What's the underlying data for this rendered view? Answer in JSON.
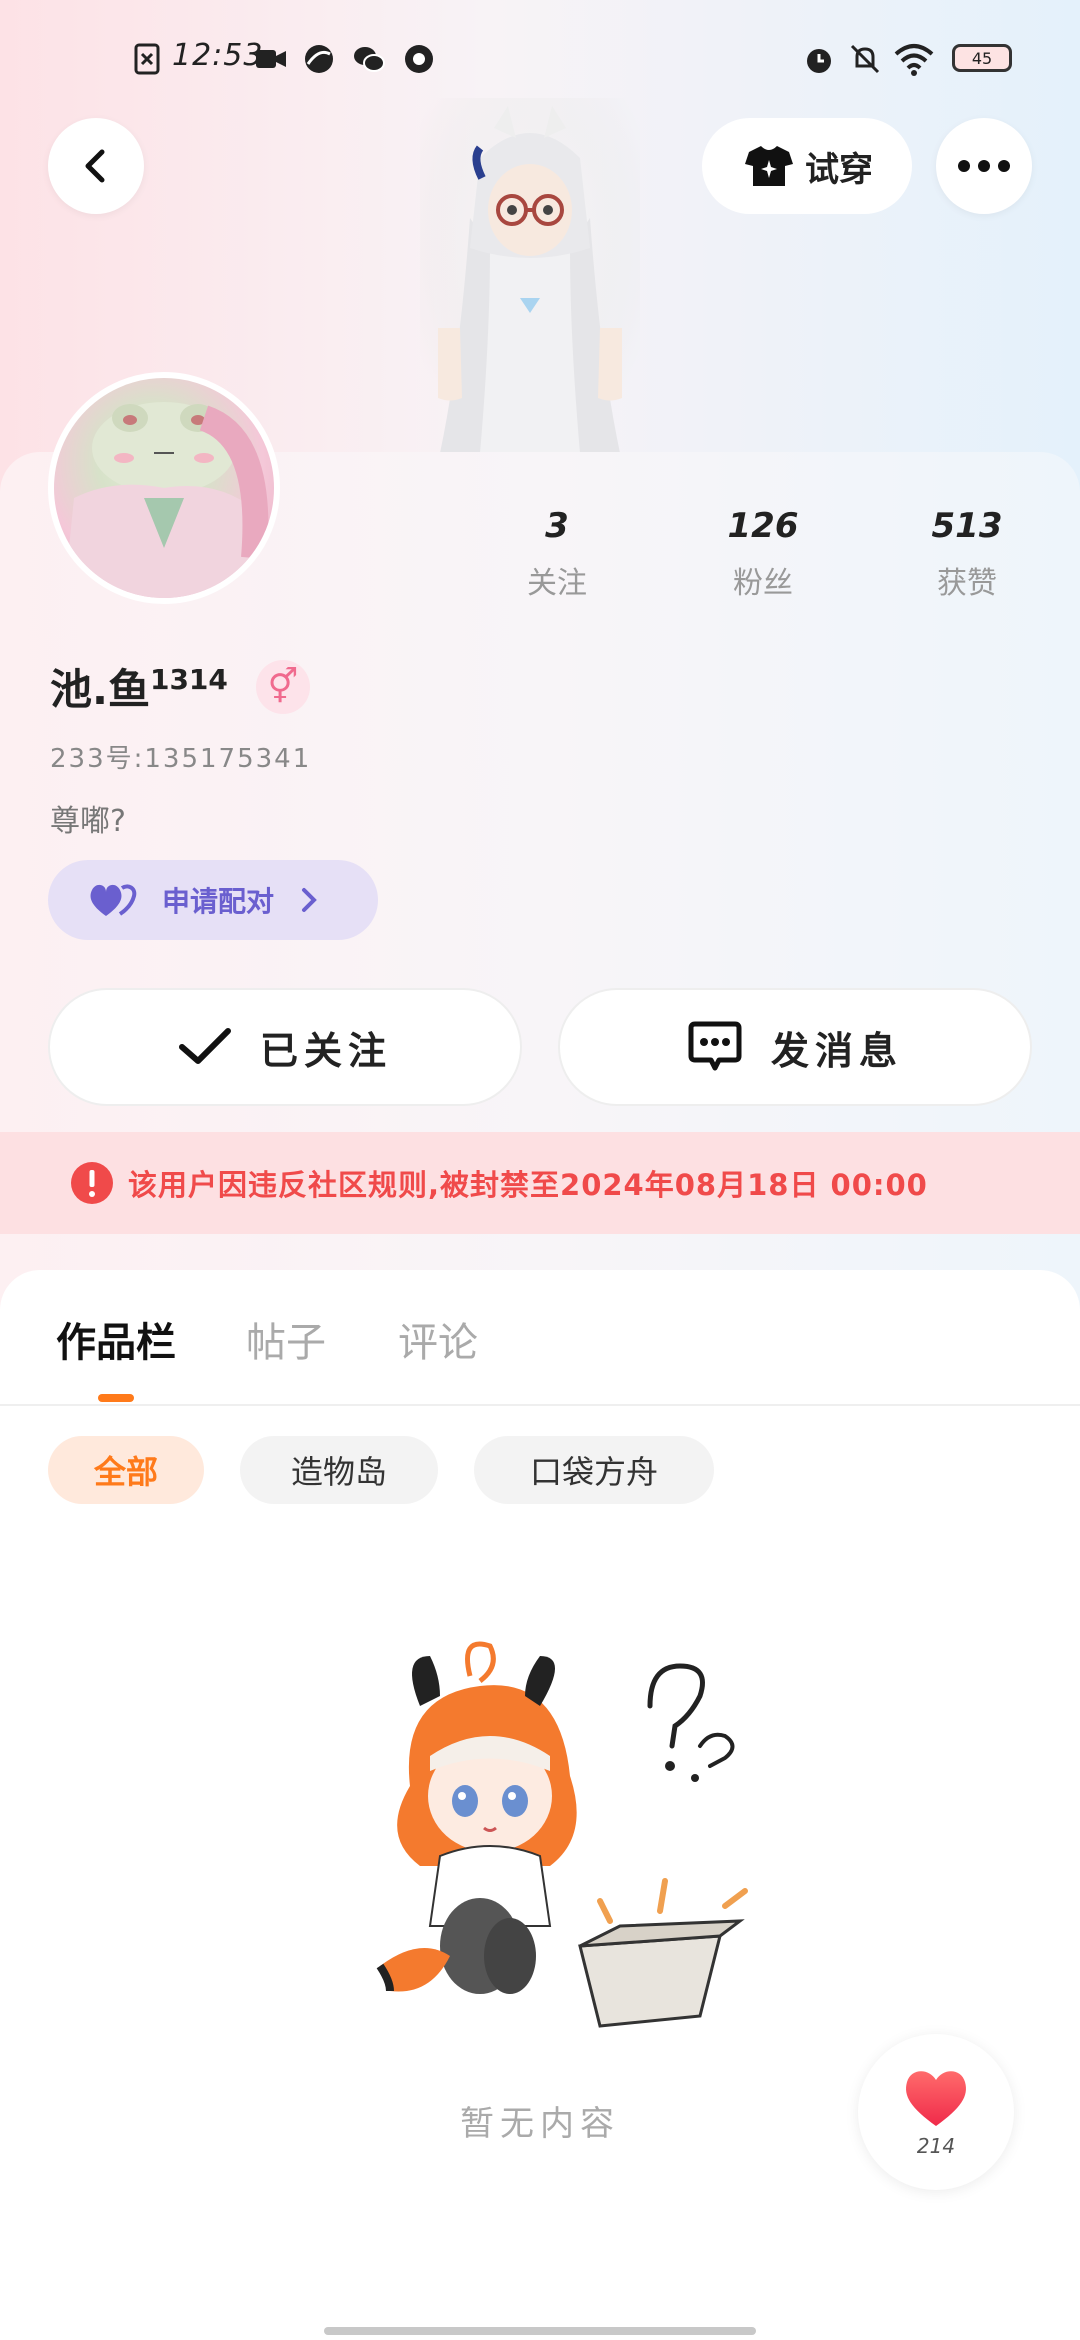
{
  "status_bar": {
    "time": "12:53",
    "battery": "45"
  },
  "header": {
    "try_on_label": "试穿"
  },
  "stats": [
    {
      "value": "3",
      "label": "关注"
    },
    {
      "value": "126",
      "label": "粉丝"
    },
    {
      "value": "513",
      "label": "获赞"
    }
  ],
  "profile": {
    "name": "池.鱼",
    "name_suffix": "1314",
    "gender_symbol": "⚥",
    "uid": "233号:135175341",
    "bio": "尊嘟?",
    "pair_label": "申请配对"
  },
  "actions": {
    "following_label": "已关注",
    "message_label": "发消息"
  },
  "ban_notice": "该用户因违反社区规则,被封禁至2024年08月18日 00:00",
  "tabs": [
    "作品栏",
    "帖子",
    "评论"
  ],
  "filters": [
    "全部",
    "造物岛",
    "口袋方舟"
  ],
  "empty_text": "暂无内容",
  "like_count": "214",
  "colors": {
    "accent": "#ff7a1a",
    "ban_text": "#f04a4a",
    "pair": "#6a5fcf"
  }
}
